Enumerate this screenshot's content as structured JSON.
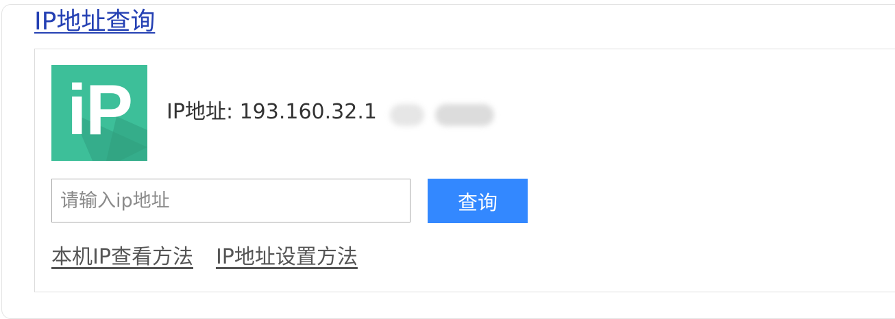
{
  "header": {
    "title": "IP地址查询"
  },
  "logo": {
    "text": "iP",
    "bg_color": "#3dbf99",
    "shadow_color": "#2f9f7e"
  },
  "ip_info": {
    "label_value": "IP地址: 193.160.32.1"
  },
  "search": {
    "placeholder": "请输入ip地址",
    "value": "",
    "button_label": "查询",
    "button_color": "#3388ff"
  },
  "links": [
    {
      "label": "本机IP查看方法"
    },
    {
      "label": "IP地址设置方法"
    }
  ]
}
